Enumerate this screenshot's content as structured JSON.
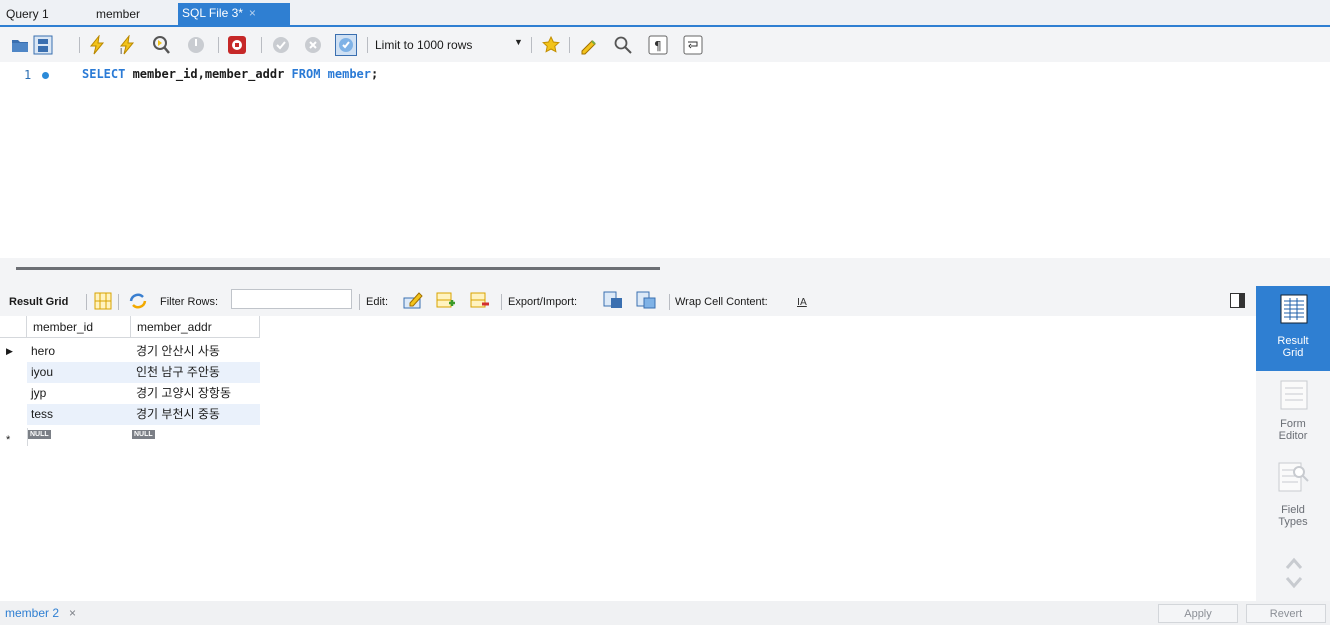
{
  "tabs": [
    {
      "label": "Query 1"
    },
    {
      "label": "member"
    },
    {
      "label": "SQL File 3*",
      "close": "×"
    }
  ],
  "toolbar": {
    "limit_label": "Limit to 1000 rows",
    "icons": [
      "open-folder-icon",
      "save-icon",
      "execute-icon",
      "execute-current-icon",
      "explain-icon",
      "stop-icon",
      "toggle-error-icon",
      "commit-icon",
      "rollback-icon",
      "autocommit-icon",
      "bookmark-star-icon",
      "beautify-icon",
      "find-icon",
      "invisible-chars-icon",
      "wrap-icon"
    ]
  },
  "editor": {
    "line_number": "1",
    "sql": {
      "kw1": "SELECT",
      "cols": " member_id,member_addr ",
      "kw2": "FROM",
      "table": " member",
      "semi": ";"
    }
  },
  "result_toolbar": {
    "result_grid": "Result Grid",
    "filter_rows": "Filter Rows:",
    "edit": "Edit:",
    "export_import": "Export/Import:",
    "wrap": "Wrap Cell Content:"
  },
  "grid": {
    "columns": [
      "member_id",
      "member_addr"
    ],
    "rows": [
      [
        "hero",
        "경기 안산시 사동"
      ],
      [
        "iyou",
        "인천 남구 주안동"
      ],
      [
        "jyp",
        "경기 고양시 장항동"
      ],
      [
        "tess",
        "경기 부천시 중동"
      ]
    ],
    "null_label": "NULL",
    "new_row_marker": "*",
    "current_row_marker": "▶"
  },
  "right_panel": {
    "result_grid": [
      "Result",
      "Grid"
    ],
    "form_editor": [
      "Form",
      "Editor"
    ],
    "field_types": [
      "Field",
      "Types"
    ]
  },
  "bottom": {
    "result_tab": "member 2",
    "close": "×",
    "apply": "Apply",
    "revert": "Revert"
  },
  "colors": {
    "accent": "#2f7fd2",
    "keyword": "#2b7bd6",
    "row_alt": "#eaf1fb"
  }
}
